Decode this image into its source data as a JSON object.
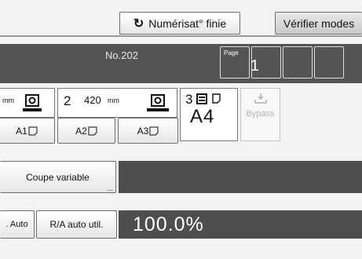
{
  "toolbar": {
    "scan_done_label": "Numérisat° finie",
    "scan_done_icon": "return-arrow-icon",
    "verify_label": "Vérifier modes"
  },
  "status": {
    "job_number": "No.202",
    "page_caption": "Page",
    "page_number": "1"
  },
  "trays": [
    {
      "unit": "mm",
      "icon": "roll-paper-icon"
    },
    {
      "number": "2",
      "size": "420",
      "unit": "mm",
      "icon": "roll-paper-icon"
    },
    {
      "number": "3",
      "size": "A4",
      "icon": "paper-stack-icon"
    }
  ],
  "paper_sizes": [
    "A1",
    "A2",
    "A3"
  ],
  "bypass": {
    "label": "Bypass",
    "icon": "bypass-tray-icon"
  },
  "cut": {
    "label": "Coupe variable",
    "more": "..."
  },
  "ratio": {
    "auto_label": ". Auto",
    "ra_label": "R/A auto util.",
    "value": "100.0%"
  },
  "colors": {
    "dark_bar": "#545454",
    "background": "#f3f3f3"
  }
}
